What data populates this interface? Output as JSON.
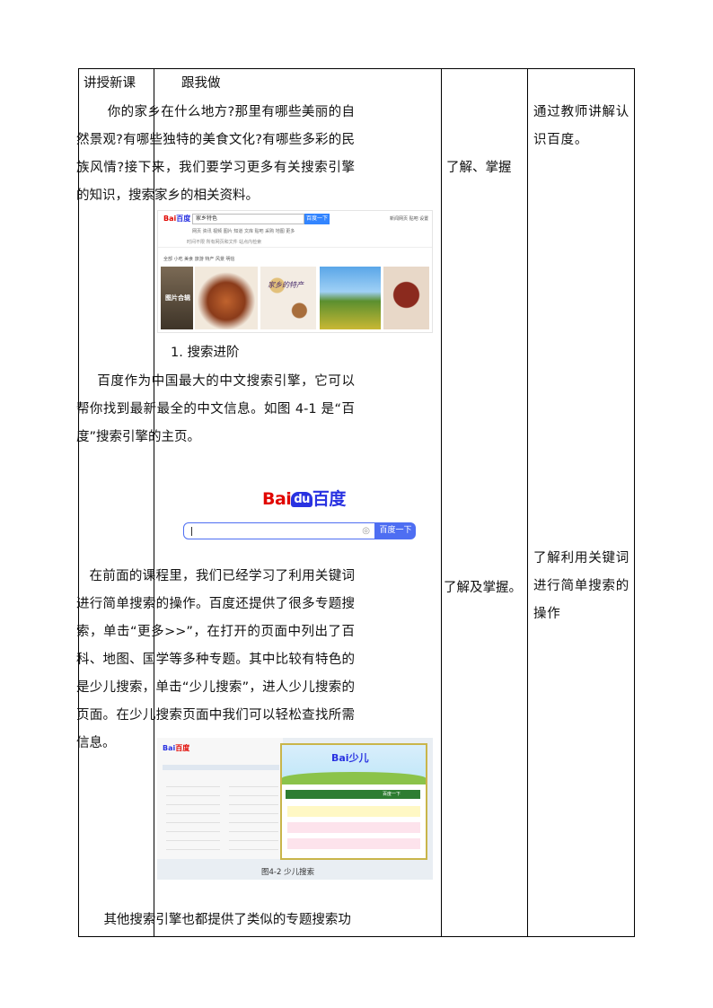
{
  "column1": {
    "label": "讲授新课"
  },
  "content": {
    "heading": "跟我做",
    "para1": "你的家乡在什么地方?那里有哪些美丽的自然景观?有哪些独特的美食文化?有哪些多彩的民族风情?接下来，我们要学习更多有关搜索引擎的知识，搜索家乡的相关资料。",
    "section1": "1. 搜索进阶",
    "para2": "百度作为中国最大的中文搜索引擎，它可以帮你找到最新最全的中文信息。如图 4-1 是“百度”搜索引擎的主页。",
    "para3": "在前面的课程里，我们已经学习了利用关键词进行简单搜索的操作。百度还提供了很多专题搜索，单击“更多>>”，在打开的页面中列出了百科、地图、国学等多种专题。其中比较有特色的是少儿搜索，单击“少儿搜索”，进人少儿搜索的页面。在少儿搜索页面中我们可以轻松查找所需信息。",
    "para4": "其他搜索引擎也都提供了类似的专题搜索功"
  },
  "search_results_image": {
    "logo_a": "Bai",
    "logo_b": "百度",
    "query": "家乡特色",
    "button": "百度一下",
    "right_links": "新闻网页  贴吧  设置",
    "tabs": "网页  资讯  视频  图片  知道  文库  贴吧  采购  地图  更多",
    "tabs2": "时间不限  所有网页和文件  站点内检索",
    "tabs3": "全部  小吃  美食  旅游  特产  风景  明信",
    "tile1_label": "图片合辑",
    "tile3_label": "家乡的特产"
  },
  "baidu_home_image": {
    "logo_bai": "Bai",
    "logo_du": "du",
    "logo_cn": "百度",
    "button": "百度一下"
  },
  "kids_image": {
    "logo": "Bai",
    "logo_cn": "少儿",
    "caption": "图4-2   少儿搜索",
    "button": "百度一下"
  },
  "column3": {
    "row1": "了解、掌握",
    "row2": "了解及掌握。"
  },
  "column4": {
    "row1": "通过教师讲解认识百度。",
    "row2": "了解利用关键词进行简单搜索的操作"
  }
}
